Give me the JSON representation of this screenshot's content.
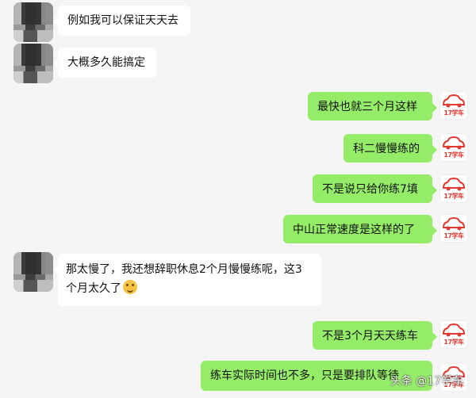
{
  "chat": {
    "messages": [
      {
        "side": "in",
        "text": "例如我可以保证天天去"
      },
      {
        "side": "in",
        "text": "大概多久能搞定"
      },
      {
        "side": "out",
        "text": "最快也就三个月这样"
      },
      {
        "side": "out",
        "text": "科二慢慢练的"
      },
      {
        "side": "out",
        "text": "不是说只给你练7填"
      },
      {
        "side": "out",
        "text": "中山正常速度是这样的了"
      },
      {
        "side": "in",
        "text_line1": "那太慢了，我还想辞职休息2个月慢慢练呢，这3",
        "text_line2": "个月太久了"
      },
      {
        "side": "out",
        "text": "不是3个月天天练车"
      },
      {
        "side": "out",
        "text": "练车实际时间也不多，只是要排队等待"
      }
    ]
  },
  "contact_avatar": {
    "brand_text": "17学车",
    "icon": "car-logo-icon"
  },
  "colors": {
    "out_bubble": "#95ec69",
    "in_bubble": "#ffffff",
    "background": "#f5f5f5",
    "brand": "#e03a30"
  },
  "watermark": "头条 @17学车"
}
